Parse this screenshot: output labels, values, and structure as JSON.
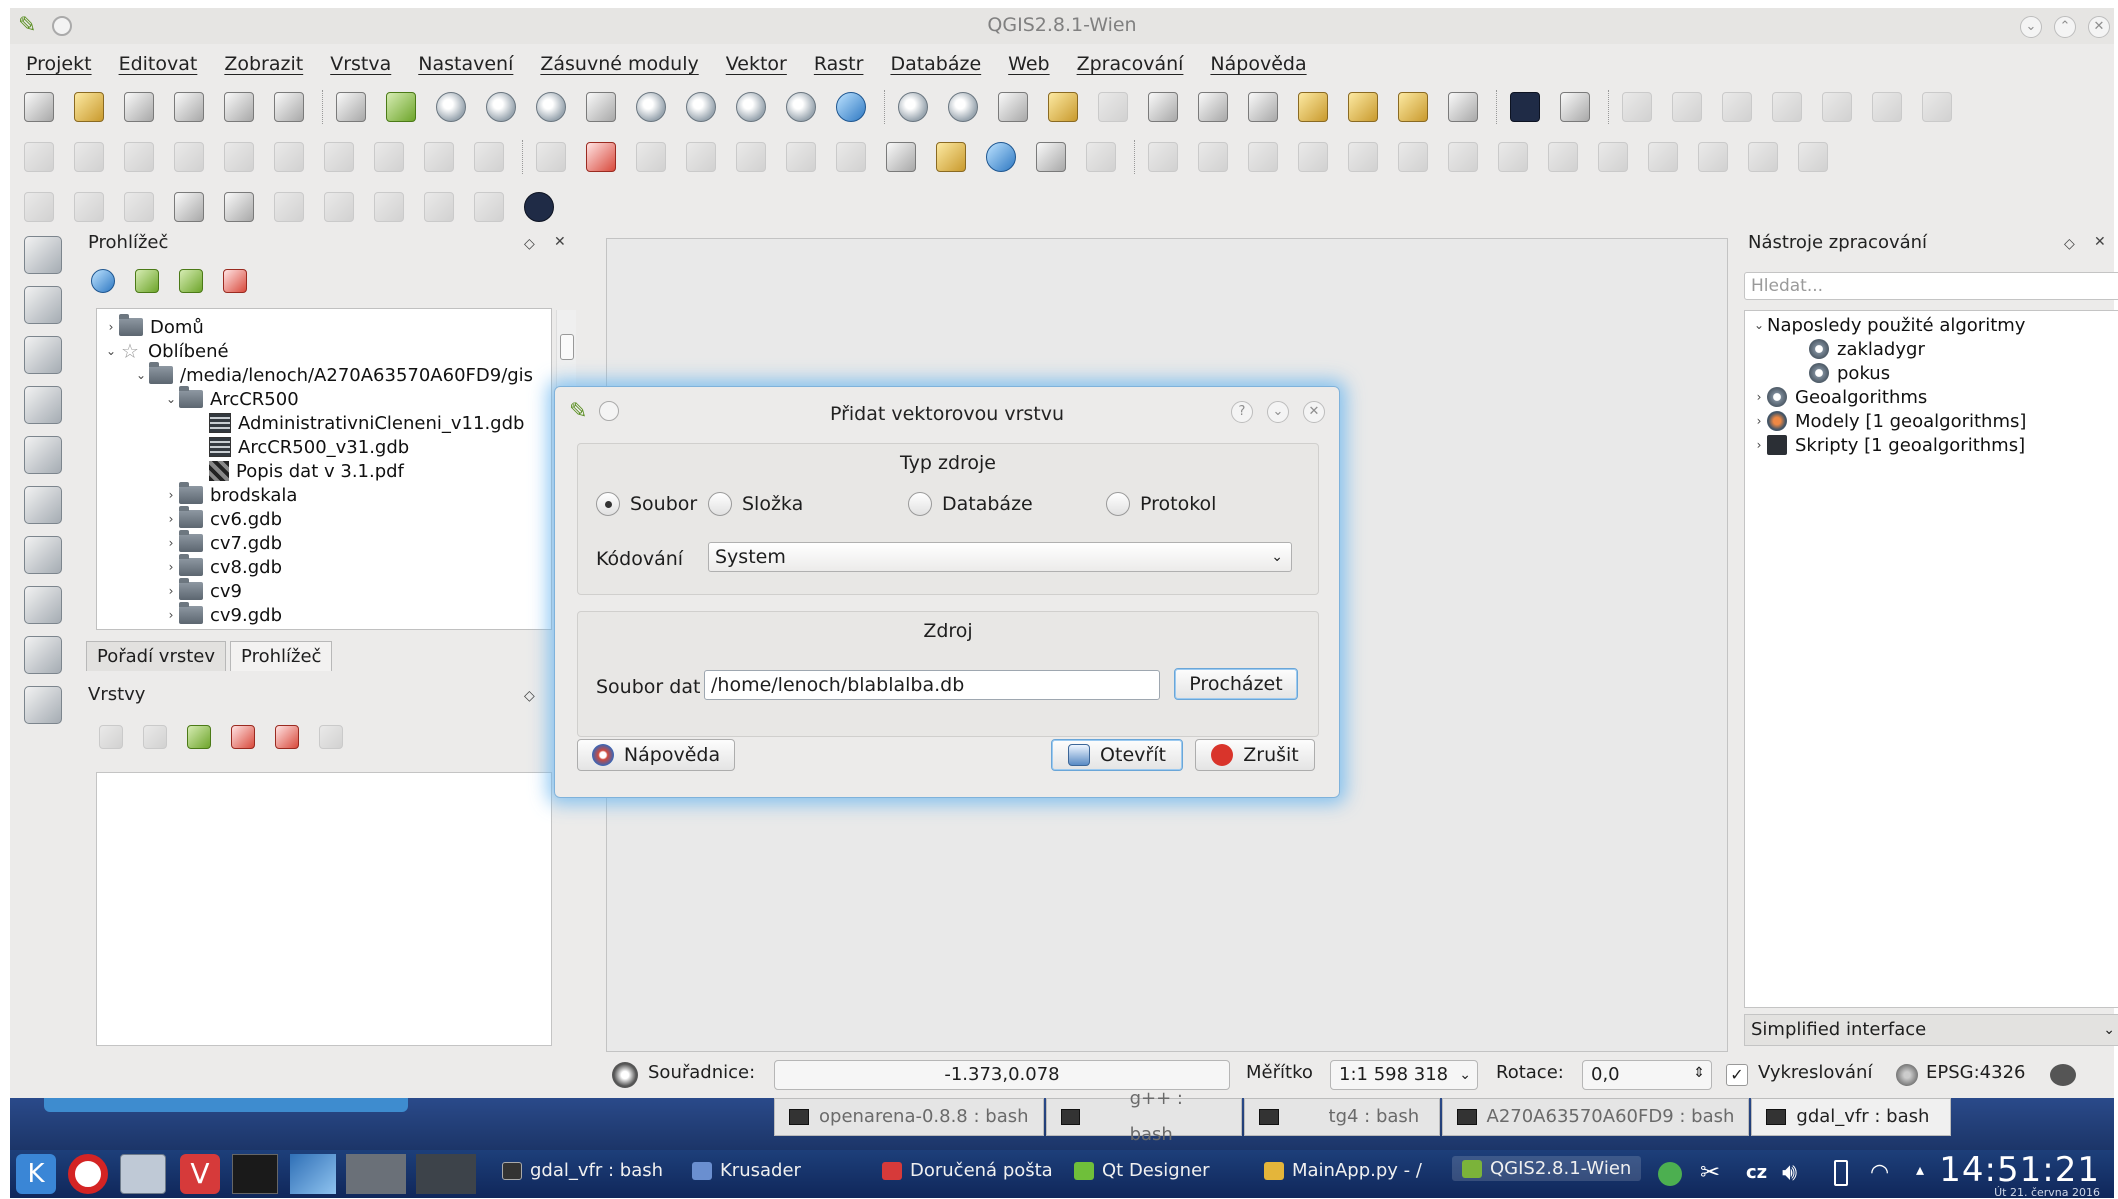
{
  "window": {
    "title": "QGIS2.8.1-Wien"
  },
  "menu": [
    "Projekt",
    "Editovat",
    "Zobrazit",
    "Vrstva",
    "Nastavení",
    "Zásuvné moduly",
    "Vektor",
    "Rastr",
    "Databáze",
    "Web",
    "Zpracování",
    "Nápověda"
  ],
  "browser_panel": {
    "title": "Prohlížeč",
    "tree": [
      "Domů",
      "Oblíbené",
      "/media/lenoch/A270A63570A60FD9/gis",
      "ArcCR500",
      "AdministrativniCleneni_v11.gdb",
      "ArcCR500_v31.gdb",
      "Popis dat v 3.1.pdf",
      "brodskala",
      "cv6.gdb",
      "cv7.gdb",
      "cv8.gdb",
      "cv9",
      "cv9.gdb"
    ]
  },
  "left_tabs": [
    "Pořadí vrstev",
    "Prohlížeč"
  ],
  "layers_panel": {
    "title": "Vrstvy"
  },
  "processing_panel": {
    "title": "Nástroje zpracování",
    "search_placeholder": "Hledat...",
    "tree": [
      "Naposledy použité algoritmy",
      "zakladygr",
      "pokus",
      "Geoalgorithms",
      "Modely [1 geoalgorithms]",
      "Skripty [1 geoalgorithms]"
    ],
    "mode": "Simplified interface"
  },
  "dialog": {
    "title": "Přidat vektorovou vrstvu",
    "source_type_title": "Typ zdroje",
    "radios": [
      "Soubor",
      "Složka",
      "Databáze",
      "Protokol"
    ],
    "selected_radio": "Soubor",
    "encoding_label": "Kódování",
    "encoding_value": "System",
    "source_title": "Zdroj",
    "file_label": "Soubor dat",
    "file_value": "/home/lenoch/blablalba.db",
    "browse_button": "Procházet",
    "help_button": "Nápověda",
    "open_button": "Otevřít",
    "cancel_button": "Zrušit"
  },
  "status": {
    "coord_label": "Souřadnice:",
    "coord_value": "-1.373,0.078",
    "scale_label": "Měřítko",
    "scale_value": "1:1 598 318",
    "rotation_label": "Rotace:",
    "rotation_value": "0,0",
    "render_label": "Vykreslování",
    "crs": "EPSG:4326"
  },
  "terminal_tabs": [
    "openarena-0.8.8 : bash",
    "g++ : bash",
    "tg4 : bash",
    "A270A63570A60FD9 : bash",
    "gdal_vfr : bash"
  ],
  "taskbar": {
    "tasks": [
      "gdal_vfr : bash",
      "Krusader",
      "Doručená pošta",
      "Qt Designer",
      "MainApp.py - /",
      "QGIS2.8.1-Wien"
    ],
    "keyboard": "cz",
    "time": "14:51:21",
    "date": "Út 21. června 2016"
  }
}
